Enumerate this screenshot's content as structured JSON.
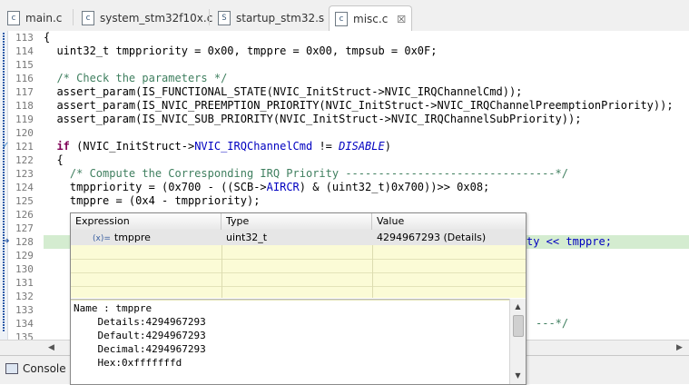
{
  "tabs": [
    {
      "icon": "c-file-icon",
      "glyph": "c",
      "label": "main.c"
    },
    {
      "icon": "c-file-icon",
      "glyph": "c",
      "label": "system_stm32f10x.c"
    },
    {
      "icon": "s-file-icon",
      "glyph": "S",
      "label": "startup_stm32.s"
    },
    {
      "icon": "c-file-icon",
      "glyph": "c",
      "label": "misc.c",
      "close": "☒"
    }
  ],
  "line_numbers": [
    "113",
    "114",
    "115",
    "116",
    "117",
    "118",
    "119",
    "120",
    "121",
    "122",
    "123",
    "124",
    "125",
    "126",
    "127",
    "128",
    "129",
    "130",
    "131",
    "132",
    "133",
    "134",
    "135"
  ],
  "code": {
    "l113": "{",
    "l114": "  uint32_t tmppriority = 0x00, tmppre = 0x00, tmpsub = 0x0F;",
    "l116": "  /* Check the parameters */",
    "l117": "  assert_param(IS_FUNCTIONAL_STATE(NVIC_InitStruct->NVIC_IRQChannelCmd));",
    "l118": "  assert_param(IS_NVIC_PREEMPTION_PRIORITY(NVIC_InitStruct->NVIC_IRQChannelPreemptionPriority));",
    "l119": "  assert_param(IS_NVIC_SUB_PRIORITY(NVIC_InitStruct->NVIC_IRQChannelSubPriority));",
    "l121_kw": "if",
    "l121_a": " (NVIC_InitStruct->",
    "l121_field": "NVIC_IRQChannelCmd",
    "l121_b": " != ",
    "l121_macro": "DISABLE",
    "l121_c": ")",
    "l122": "  {",
    "l123": "    /* Compute the Corresponding IRQ Priority --------------------------------*/",
    "l124_a": "    tmppriority = (0x700 - ((SCB->",
    "l124_field": "AIRCR",
    "l124_b": ") & (uint32_t)0x700))>> 0x08;",
    "l125": "    tmppre = (0x4 - tmppriority);",
    "l128_tail": "ty << tmppre;",
    "l134_tail": "---*/"
  },
  "popup": {
    "headers": {
      "expression": "Expression",
      "type": "Type",
      "value": "Value"
    },
    "row": {
      "icon": "(x)=",
      "expression": "tmppre",
      "type": "uint32_t",
      "value": "4294967293 (Details)"
    },
    "details": [
      "Name : tmppre",
      "    Details:4294967293",
      "    Default:4294967293",
      "    Decimal:4294967293",
      "    Hex:0xfffffffd"
    ]
  },
  "console": {
    "label": "Console",
    "close": "☒"
  },
  "colors": {
    "comment": "#3f7f5f",
    "keyword": "#7f0055",
    "field": "#0000c0",
    "highlight": "#d4ecd0",
    "popup_bg": "#fbfbd6"
  }
}
